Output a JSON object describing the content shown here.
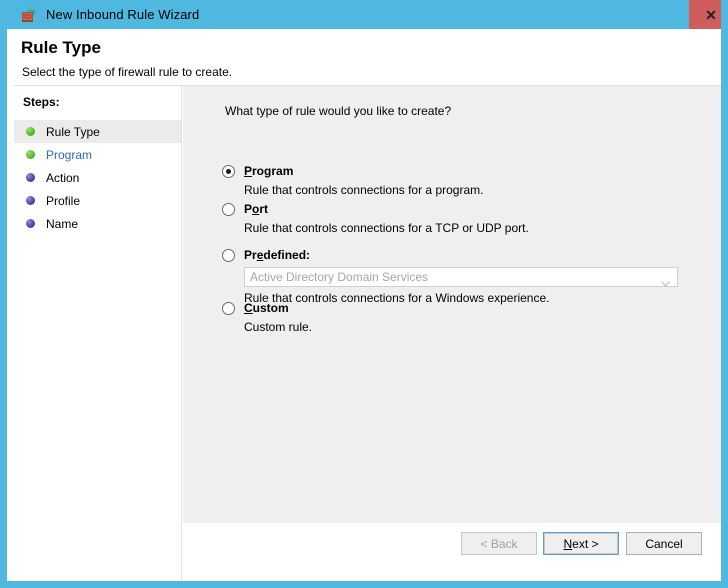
{
  "window": {
    "title": "New Inbound Rule Wizard",
    "icon": "firewall-brick-wall-icon",
    "close_label": "✕",
    "accent_color": "#4fb8e0",
    "close_button_color": "#d15c5c"
  },
  "header": {
    "title": "Rule Type",
    "subtitle": "Select the type of firewall rule to create."
  },
  "sidebar": {
    "heading": "Steps:",
    "items": [
      {
        "label": "Rule Type",
        "state": "current",
        "bullet": "green"
      },
      {
        "label": "Program",
        "state": "link",
        "bullet": "green"
      },
      {
        "label": "Action",
        "state": "pending",
        "bullet": "blue"
      },
      {
        "label": "Profile",
        "state": "pending",
        "bullet": "blue"
      },
      {
        "label": "Name",
        "state": "pending",
        "bullet": "blue"
      }
    ]
  },
  "content": {
    "question": "What type of rule would you like to create?",
    "options": [
      {
        "id": "program",
        "title": "Program",
        "accel": "P",
        "description": "Rule that controls connections for a program.",
        "selected": true
      },
      {
        "id": "port",
        "title": "Port",
        "accel": "o",
        "description": "Rule that controls connections for a TCP or UDP port.",
        "selected": false
      },
      {
        "id": "predefined",
        "title": "Predefined:",
        "accel": "e",
        "description": "Rule that controls connections for a Windows experience.",
        "selected": false,
        "combo": {
          "value": "Active Directory Domain Services",
          "disabled": true
        }
      },
      {
        "id": "custom",
        "title": "Custom",
        "accel": "C",
        "description": "Custom rule.",
        "selected": false
      }
    ]
  },
  "footer": {
    "back": {
      "label": "< Back",
      "disabled": true
    },
    "next": {
      "label": "Next >",
      "accel": "N",
      "default": true
    },
    "cancel": {
      "label": "Cancel",
      "disabled": false
    }
  }
}
